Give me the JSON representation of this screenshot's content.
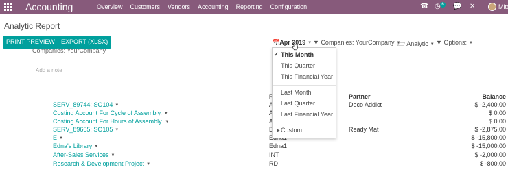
{
  "navbar": {
    "brand": "Accounting",
    "menu": [
      "Overview",
      "Customers",
      "Vendors",
      "Accounting",
      "Reporting",
      "Configuration"
    ],
    "notification_count": "6",
    "user": "Mitch"
  },
  "page": {
    "title": "Analytic Report"
  },
  "toolbar": {
    "print_label": "PRINT PREVIEW",
    "export_label": "EXPORT (XLSX)",
    "date_filter": "Apr 2019",
    "companies_filter": "Companies: YourCompany",
    "analytic_filter": "Analytic",
    "options_filter": "Options:"
  },
  "report": {
    "companies_line": "Companies:   YourCompany",
    "note_placeholder": "Add a note",
    "headers": {
      "reference": "R",
      "partner": "Partner",
      "balance": "Balance"
    },
    "rows": [
      {
        "name": "SERV_89744: SO104",
        "ref": "A",
        "partner": "Deco Addict",
        "balance": "$ -2,400.00"
      },
      {
        "name": "Costing Account For Cycle of Assembly.",
        "ref": "A",
        "partner": "",
        "balance": "$ 0.00"
      },
      {
        "name": "Costing Account For Hours of Assembly.",
        "ref": "A",
        "partner": "",
        "balance": "$ 0.00"
      },
      {
        "name": "SERV_89665: SO105",
        "ref": "D",
        "partner": "Ready Mat",
        "balance": "$ -2,875.00"
      },
      {
        "name": "E",
        "ref": "Edna1",
        "partner": "",
        "balance": "$ -15,800.00"
      },
      {
        "name": "Edna's Library",
        "ref": "Edna1",
        "partner": "",
        "balance": "$ -15,000.00"
      },
      {
        "name": "After-Sales Services",
        "ref": "INT",
        "partner": "",
        "balance": "$ -2,000.00"
      },
      {
        "name": "Research & Development Project",
        "ref": "RD",
        "partner": "",
        "balance": "$ -800.00"
      }
    ]
  },
  "date_dropdown": {
    "items": [
      "This Month",
      "This Quarter",
      "This Financial Year",
      "Last Month",
      "Last Quarter",
      "Last Financial Year",
      "Custom"
    ],
    "selected": "This Month"
  },
  "colors": {
    "navbar": "#875a7b",
    "accent": "#00a09d"
  }
}
